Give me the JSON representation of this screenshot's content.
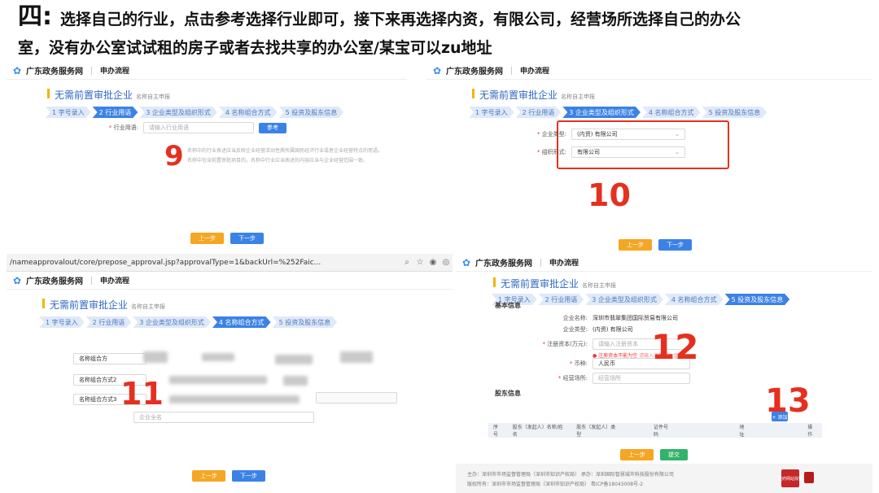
{
  "title": {
    "num": "四:",
    "line1": "选择自己的行业，点击参考选择行业即可，接下来再选择内资，有限公司，经营场所选择自己的办公",
    "line2": "室，没有办公室试试租的房子或者去找共享的办公室/某宝可以zu地址"
  },
  "common": {
    "site_name": "广东政务服务网",
    "flow": "申办流程",
    "page_title": "无需前置审批企业",
    "page_sub": "名称自主申报",
    "prev": "上一步",
    "next": "下一步",
    "steps": [
      "1 字号录入",
      "2 行业用语",
      "3 企业类型及组织形式",
      "4 名称组合方式",
      "5 投资及股东信息"
    ]
  },
  "shot9": {
    "industry_label": "行业用语:",
    "industry_placeholder": "请输入行业用语",
    "ref_button": "参考",
    "note1": "名称中的行业表述应当反映企业经营活动性质所属国民经济行业或者企业经营特点的用语。",
    "note2": "名称中包含前置审批项目的，名称中行业应当表述的内容应当与企业经营范围一致。",
    "annotation": "9"
  },
  "shot10": {
    "type_label": "企业类型:",
    "type_value": "(内资) 有限公司",
    "org_label": "组织形式:",
    "org_value": "有限公司",
    "annotation": "10"
  },
  "shot11": {
    "url": "/nameapprovalout/core/prepose_approval.jsp?approvalType=1&backUrl=%252Faic...",
    "combo1": "名称组合方",
    "combo2": "名称组合方式2",
    "combo3": "名称组合方式3",
    "company_placeholder": "企业全名",
    "annotation": "11"
  },
  "shot12": {
    "basic_info": "基本信息",
    "company_name_label": "企业名称:",
    "company_name_value": "深圳市翡翠集团国际贸易有限公司",
    "company_type_label": "企业类型:",
    "company_type_value": "(内资) 有限公司",
    "capital_label": "注册资本(万元):",
    "capital_placeholder": "请输入注册资本",
    "capital_error": "注册资本不能为空",
    "capital_hint": "请输入注册资本金额",
    "currency_label": "币种:",
    "currency_value": "人民币",
    "premises_label": "经营场所:",
    "premises_placeholder": "经营场所",
    "shareholder_info": "股东信息",
    "add_button": "+ 添加",
    "table_headers": [
      "序号",
      "股东（发起人）名称/姓名",
      "股东（发起人）类型",
      "证件号码",
      "地址",
      "操作"
    ],
    "save_button": "上一步",
    "submit_button": "提交",
    "footer1": "主办：深圳市市场监督管理局（深圳市知识产权局）   承办：深圳国际智慧城市科技股份有限公司",
    "footer2": "版权所有：深圳市市场监督管理局（深圳市知识产权局）   粤ICP备18043008号-2",
    "seal_text": "政府网站找错",
    "annotation12": "12",
    "annotation13": "13"
  }
}
